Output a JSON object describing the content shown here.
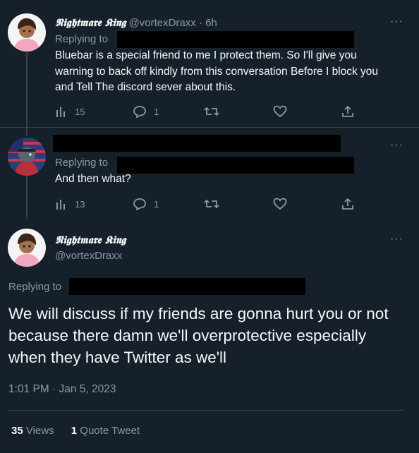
{
  "tweet1": {
    "display_name": "𝕹𝖎𝖌𝖍𝖙𝖒𝖆𝖗𝖊 𝕶𝖎𝖓𝖌",
    "handle": "@vortexDraxx",
    "sep": "·",
    "time": "6h",
    "replying_to": "Replying to",
    "text": "Bluebar is a special friend to me I protect them. So I'll give you warning to back off kindly from this conversation Before I block you and Tell The discord sever about this.",
    "views": "15",
    "replies": "1",
    "more": "···"
  },
  "tweet2": {
    "replying_to": "Replying to",
    "text": "And then what?",
    "views": "13",
    "replies": "1",
    "more": "···"
  },
  "main": {
    "display_name": "𝕹𝖎𝖌𝖍𝖙𝖒𝖆𝖗𝖊 𝕶𝖎𝖓𝖌",
    "handle": "@vortexDraxx",
    "replying_to": "Replying to",
    "text": "We will discuss if my friends are gonna hurt you or not because there damn we'll overprotective especially when they have Twitter as we'll",
    "timestamp": "1:01 PM · Jan 5, 2023",
    "more": "···"
  },
  "stats": {
    "views_count": "35",
    "views_label": "Views",
    "quote_count": "1",
    "quote_label": "Quote Tweet"
  },
  "icons": [
    "analytics-icon",
    "reply-icon",
    "retweet-icon",
    "like-icon",
    "share-icon",
    "more-icon"
  ],
  "colors": {
    "background": "#15202b",
    "text": "#f7f9f9",
    "muted": "#8b98a5",
    "divider": "#38444d"
  }
}
